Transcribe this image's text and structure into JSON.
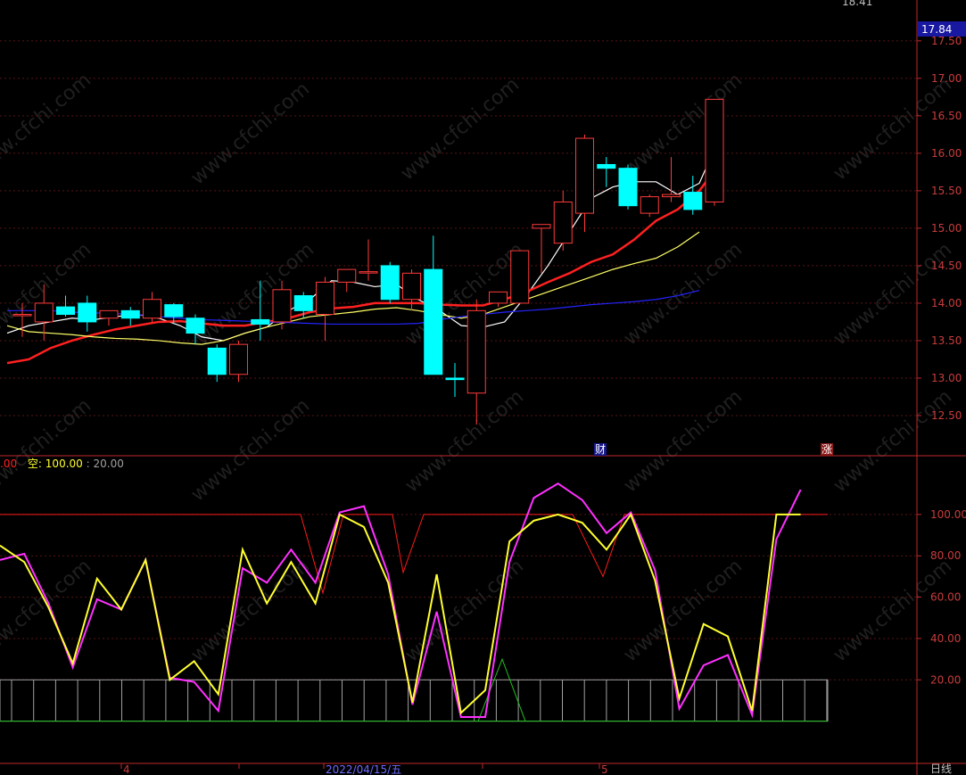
{
  "header": {
    "top_price": "18.41",
    "current_price": "17.84",
    "osc_legend": {
      "prefix": ".00",
      "label": "空:",
      "value": "100.00",
      "sep": ": 20.00"
    }
  },
  "markers": {
    "finance": "财",
    "limit_up": "涨"
  },
  "footer": {
    "period_label": "日线"
  },
  "watermark": "www.cfchi.com",
  "colors": {
    "bg": "#000000",
    "axis": "#c0282d",
    "grid": "#5a1414",
    "up_candle": "#ff3a3a",
    "down_candle": "#00ffff",
    "ma5": "#ffffff",
    "ma10": "#ff2020",
    "ma20": "#ffff66",
    "ma60": "#2424ff",
    "k_line": "#ff30ff",
    "d_line": "#ffff30",
    "j_line": "#ff1a1a",
    "green_line": "#20c020",
    "price_box": "#1818a0"
  },
  "chart_data": [
    {
      "type": "candlestick",
      "title": "",
      "ylim": [
        12.0,
        17.95
      ],
      "y_ticks": [
        "12.50",
        "13.00",
        "13.50",
        "14.00",
        "14.50",
        "15.00",
        "15.50",
        "16.00",
        "16.50",
        "17.00",
        "17.50",
        "17.84"
      ],
      "x_labels": [
        "4",
        "2022/04/15/五",
        "5"
      ],
      "candles": [
        {
          "o": 13.85,
          "h": 14.0,
          "l": 13.55,
          "c": 13.85
        },
        {
          "o": 13.75,
          "h": 14.25,
          "l": 13.5,
          "c": 14.0
        },
        {
          "o": 13.95,
          "h": 14.1,
          "l": 13.82,
          "c": 13.85
        },
        {
          "o": 14.0,
          "h": 14.1,
          "l": 13.62,
          "c": 13.75
        },
        {
          "o": 13.8,
          "h": 13.9,
          "l": 13.7,
          "c": 13.9
        },
        {
          "o": 13.9,
          "h": 13.95,
          "l": 13.7,
          "c": 13.8
        },
        {
          "o": 13.8,
          "h": 14.15,
          "l": 13.75,
          "c": 14.05
        },
        {
          "o": 13.98,
          "h": 14.0,
          "l": 13.72,
          "c": 13.82
        },
        {
          "o": 13.8,
          "h": 13.85,
          "l": 13.45,
          "c": 13.6
        },
        {
          "o": 13.4,
          "h": 13.45,
          "l": 12.95,
          "c": 13.05
        },
        {
          "o": 13.05,
          "h": 13.5,
          "l": 12.95,
          "c": 13.45
        },
        {
          "o": 13.78,
          "h": 14.3,
          "l": 13.5,
          "c": 13.72
        },
        {
          "o": 13.75,
          "h": 14.3,
          "l": 13.65,
          "c": 14.18
        },
        {
          "o": 14.1,
          "h": 14.15,
          "l": 13.8,
          "c": 13.9
        },
        {
          "o": 13.85,
          "h": 14.35,
          "l": 13.5,
          "c": 14.28
        },
        {
          "o": 14.28,
          "h": 14.45,
          "l": 14.15,
          "c": 14.45
        },
        {
          "o": 14.42,
          "h": 14.85,
          "l": 14.3,
          "c": 14.42
        },
        {
          "o": 14.5,
          "h": 14.55,
          "l": 14.0,
          "c": 14.05
        },
        {
          "o": 14.05,
          "h": 14.45,
          "l": 13.9,
          "c": 14.4
        },
        {
          "o": 14.45,
          "h": 14.9,
          "l": 13.05,
          "c": 13.05
        },
        {
          "o": 13.0,
          "h": 13.2,
          "l": 12.75,
          "c": 12.98
        },
        {
          "o": 12.8,
          "h": 14.05,
          "l": 12.38,
          "c": 13.9
        },
        {
          "o": 14.0,
          "h": 14.15,
          "l": 13.95,
          "c": 14.15
        },
        {
          "o": 14.0,
          "h": 14.7,
          "l": 14.0,
          "c": 14.7
        },
        {
          "o": 15.0,
          "h": 15.05,
          "l": 14.4,
          "c": 15.05
        },
        {
          "o": 14.8,
          "h": 15.5,
          "l": 14.7,
          "c": 15.35
        },
        {
          "o": 15.2,
          "h": 16.25,
          "l": 14.95,
          "c": 16.2
        },
        {
          "o": 15.85,
          "h": 15.95,
          "l": 15.55,
          "c": 15.8
        },
        {
          "o": 15.8,
          "h": 15.85,
          "l": 15.25,
          "c": 15.3
        },
        {
          "o": 15.2,
          "h": 15.45,
          "l": 15.15,
          "c": 15.42
        },
        {
          "o": 15.42,
          "h": 15.95,
          "l": 15.35,
          "c": 15.45
        },
        {
          "o": 15.48,
          "h": 15.7,
          "l": 15.18,
          "c": 15.25
        },
        {
          "o": 15.35,
          "h": 16.72,
          "l": 15.3,
          "c": 16.72
        }
      ],
      "series": [
        {
          "name": "",
          "color_key": "ma5",
          "values": [
            13.6,
            13.7,
            13.75,
            13.8,
            13.78,
            13.82,
            13.85,
            13.8,
            13.7,
            13.55,
            13.5,
            13.6,
            13.68,
            13.9,
            14.05,
            14.3,
            14.28,
            14.22,
            14.25,
            14.05,
            13.9,
            13.7,
            13.68,
            13.75,
            14.1,
            14.5,
            14.95,
            15.4,
            15.55,
            15.62,
            15.62,
            15.45,
            15.6,
            16.25
          ]
        },
        {
          "name": "",
          "color_key": "ma10",
          "values": [
            13.2,
            13.25,
            13.4,
            13.5,
            13.58,
            13.65,
            13.7,
            13.75,
            13.76,
            13.73,
            13.7,
            13.7,
            13.75,
            13.8,
            13.88,
            13.93,
            13.95,
            14.0,
            14.0,
            14.0,
            13.98,
            13.97,
            13.97,
            14.05,
            14.15,
            14.28,
            14.4,
            14.55,
            14.65,
            14.85,
            15.1,
            15.25,
            15.5,
            15.88
          ]
        },
        {
          "name": "",
          "color_key": "ma20",
          "values": [
            13.7,
            13.62,
            13.6,
            13.58,
            13.55,
            13.53,
            13.52,
            13.5,
            13.47,
            13.45,
            13.5,
            13.6,
            13.68,
            13.75,
            13.82,
            13.85,
            13.88,
            13.92,
            13.94,
            13.9,
            13.85,
            13.8,
            13.85,
            13.95,
            14.05,
            14.15,
            14.25,
            14.35,
            14.45,
            14.53,
            14.6,
            14.75,
            14.95
          ]
        },
        {
          "name": "",
          "color_key": "ma60",
          "values": [
            13.9,
            13.9,
            13.9,
            13.88,
            13.87,
            13.86,
            13.85,
            13.82,
            13.8,
            13.78,
            13.77,
            13.76,
            13.75,
            13.74,
            13.73,
            13.72,
            13.72,
            13.72,
            13.72,
            13.73,
            13.78,
            13.82,
            13.85,
            13.88,
            13.9,
            13.92,
            13.95,
            13.98,
            14.0,
            14.02,
            14.05,
            14.1,
            14.17
          ]
        }
      ]
    },
    {
      "type": "line",
      "title": "",
      "ylim": [
        -20,
        128
      ],
      "y_ticks": [
        "20.00",
        "40.00",
        "60.00",
        "80.00",
        "100.00"
      ],
      "series": [
        {
          "name": "",
          "color_key": "k_line",
          "values": [
            78,
            81,
            57,
            26,
            59,
            54,
            78,
            21,
            19,
            5,
            74,
            67,
            83,
            67,
            101,
            104,
            71,
            8,
            53,
            2,
            2,
            77,
            108,
            115,
            107,
            91,
            101,
            73,
            6,
            27,
            32,
            3,
            88,
            112
          ]
        },
        {
          "name": "",
          "color_key": "d_line",
          "values": [
            85,
            77,
            55,
            28,
            69,
            54,
            78,
            20,
            29,
            13,
            83,
            57,
            77,
            57,
            100,
            94,
            67,
            9,
            71,
            4,
            15,
            87,
            97,
            100,
            96,
            83,
            100,
            68,
            11,
            47,
            41,
            5,
            100,
            100
          ]
        },
        {
          "name": "",
          "color_key": "j_line",
          "values": [
            100,
            100,
            100,
            100,
            100,
            100,
            100,
            100,
            100,
            100,
            100,
            100,
            100,
            100,
            100,
            100,
            100,
            100,
            100,
            100,
            100,
            100,
            100,
            100,
            100,
            100,
            100,
            100,
            100,
            100,
            100,
            100,
            100,
            100
          ]
        },
        {
          "name": "",
          "color_key": "green_line",
          "values": [
            0,
            0,
            0,
            0,
            0,
            0,
            0,
            0,
            0,
            0,
            0,
            0,
            0,
            0,
            0,
            0,
            0,
            0,
            0,
            0,
            10,
            30,
            0,
            0,
            0,
            0,
            0,
            0,
            0,
            0,
            0,
            0,
            0,
            0
          ]
        }
      ]
    }
  ]
}
